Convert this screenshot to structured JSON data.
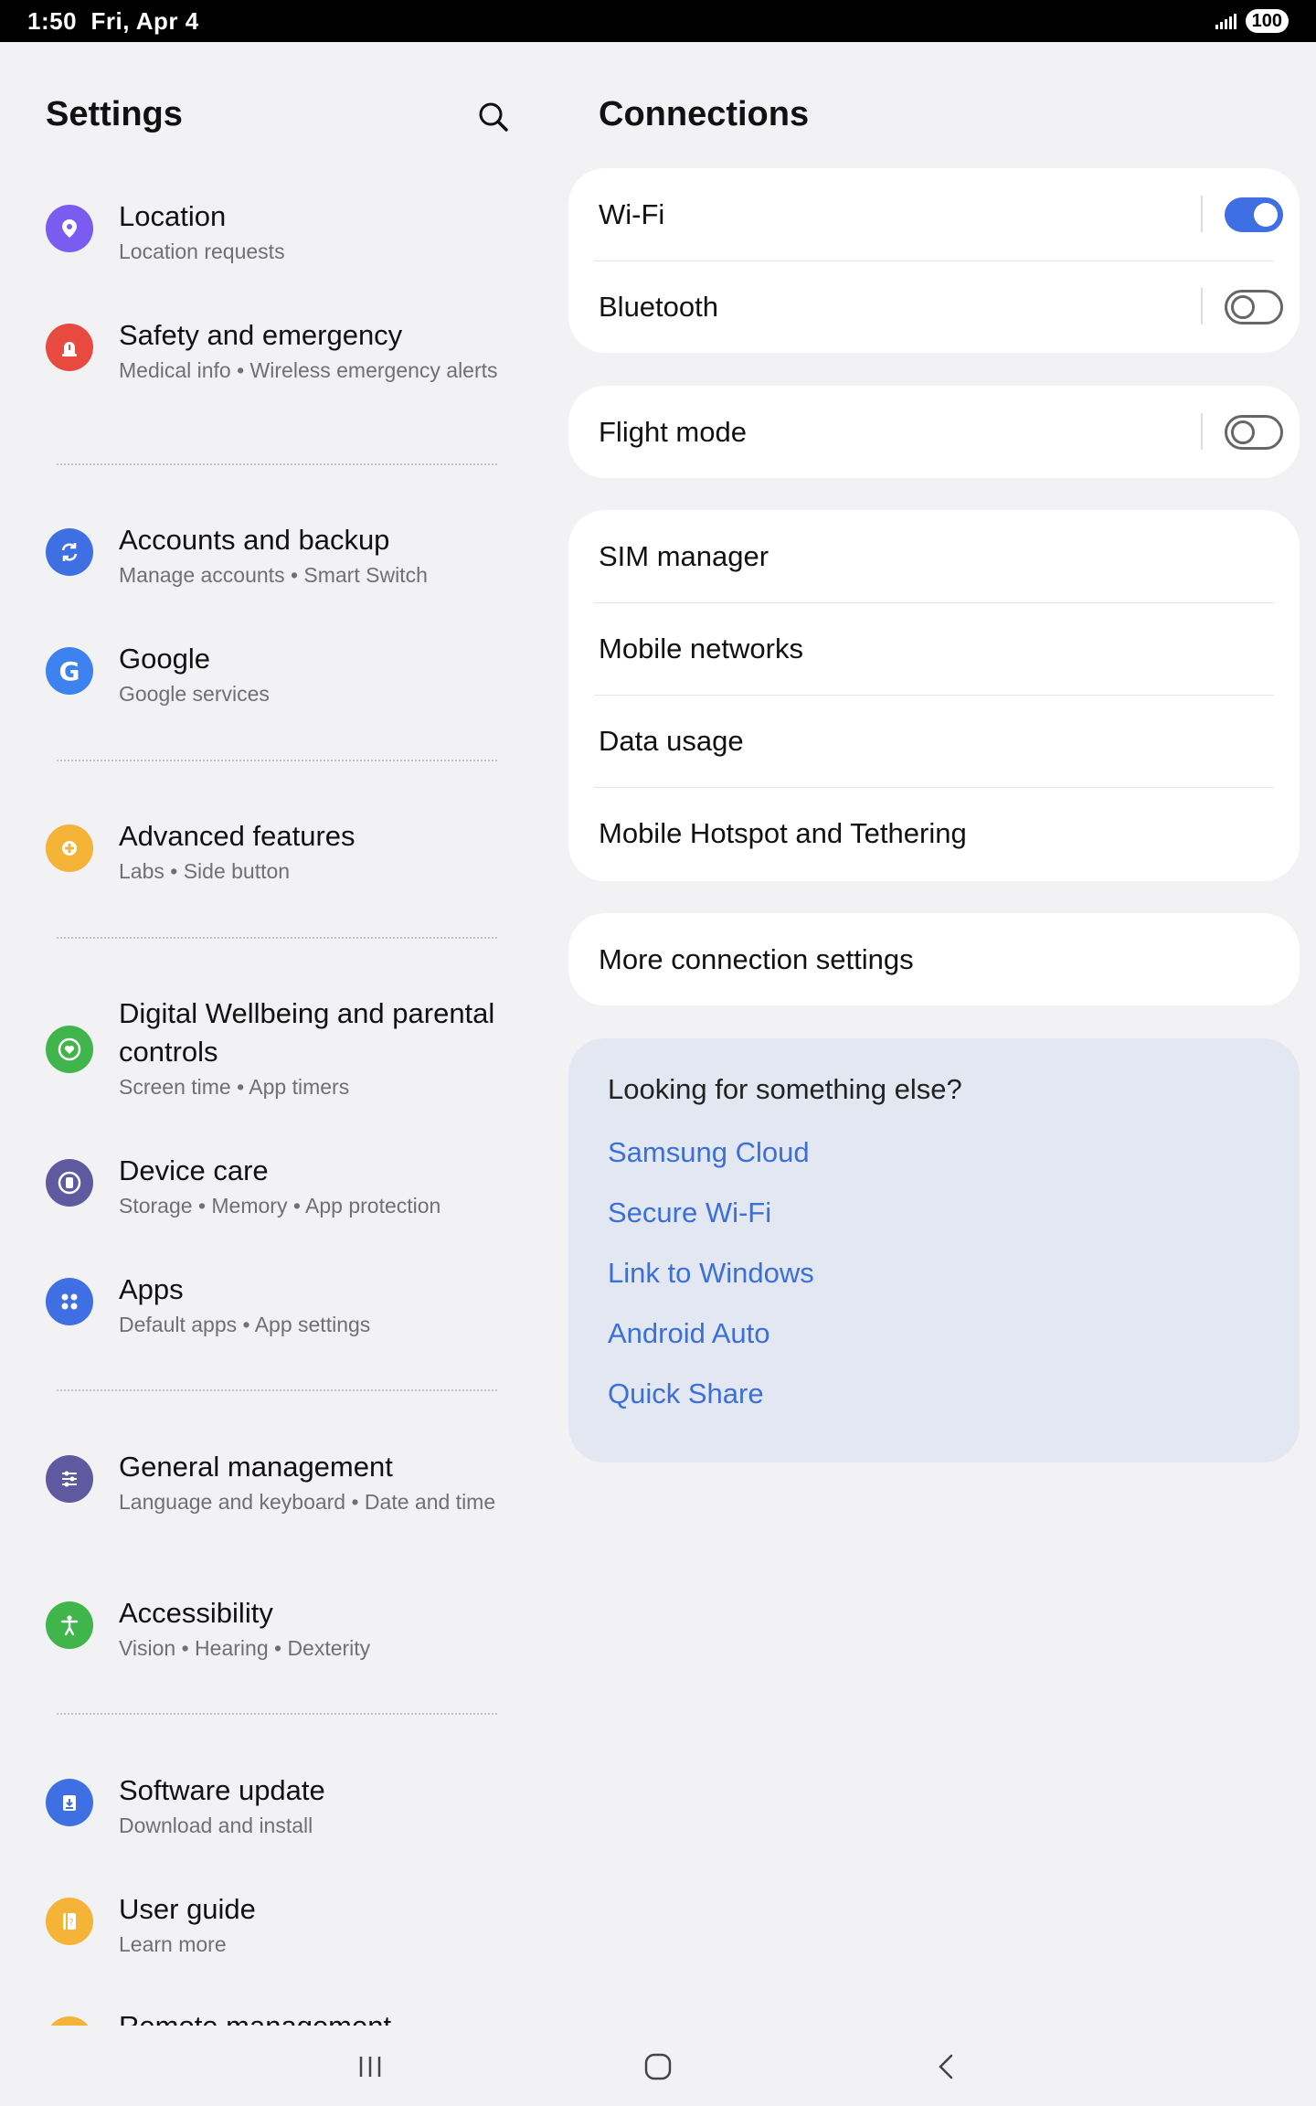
{
  "status_bar": {
    "time": "1:50",
    "date": "Fri, Apr 4",
    "battery": "100"
  },
  "settings": {
    "title": "Settings",
    "items": [
      {
        "title": "Location",
        "subtitle": "Location requests",
        "icon": "location-pin-icon",
        "color": "#7a5cf0"
      },
      {
        "title": "Safety and emergency",
        "subtitle": "Medical info  •  Wireless emergency alerts",
        "icon": "siren-icon",
        "color": "#e84a3f"
      },
      {
        "title": "Accounts and backup",
        "subtitle": "Manage accounts  •  Smart Switch",
        "icon": "sync-icon",
        "color": "#3e6fe3"
      },
      {
        "title": "Google",
        "subtitle": "Google services",
        "icon": "google-icon",
        "color": "#3e82f0"
      },
      {
        "title": "Advanced features",
        "subtitle": "Labs  •  Side button",
        "icon": "gear-plus-icon",
        "color": "#f5b338"
      },
      {
        "title": "Digital Wellbeing and parental controls",
        "subtitle": "Screen time  •  App timers",
        "icon": "heart-circle-icon",
        "color": "#3fb54c"
      },
      {
        "title": "Device care",
        "subtitle": "Storage  •  Memory  •  App protection",
        "icon": "device-care-icon",
        "color": "#5f5aa0"
      },
      {
        "title": "Apps",
        "subtitle": "Default apps  •  App settings",
        "icon": "apps-grid-icon",
        "color": "#3e6fe3"
      },
      {
        "title": "General management",
        "subtitle": "Language and keyboard  •  Date and time",
        "icon": "sliders-icon",
        "color": "#5f5aa0"
      },
      {
        "title": "Accessibility",
        "subtitle": "Vision  •  Hearing  •  Dexterity",
        "icon": "accessibility-icon",
        "color": "#3fb54c"
      },
      {
        "title": "Software update",
        "subtitle": "Download and install",
        "icon": "download-icon",
        "color": "#3e6fe3"
      },
      {
        "title": "User guide",
        "subtitle": "Learn more",
        "icon": "book-icon",
        "color": "#f5b338"
      },
      {
        "title": "Remote management",
        "subtitle": "",
        "icon": "remote-icon",
        "color": "#f5b338"
      }
    ]
  },
  "connections": {
    "title": "Connections",
    "wifi": {
      "label": "Wi-Fi",
      "on": true
    },
    "bluetooth": {
      "label": "Bluetooth",
      "on": false
    },
    "flight_mode": {
      "label": "Flight mode",
      "on": false
    },
    "sim_manager": "SIM manager",
    "mobile_networks": "Mobile networks",
    "data_usage": "Data usage",
    "hotspot": "Mobile Hotspot and Tethering",
    "more_settings": "More connection settings",
    "suggestions": {
      "title": "Looking for something else?",
      "links": [
        "Samsung Cloud",
        "Secure Wi-Fi",
        "Link to Windows",
        "Android Auto",
        "Quick Share"
      ]
    }
  },
  "colors": {
    "accent": "#3e6fe3",
    "link": "#3b6fd9",
    "background": "#f2f2f5",
    "suggestion_bg": "#e2e7f2"
  }
}
